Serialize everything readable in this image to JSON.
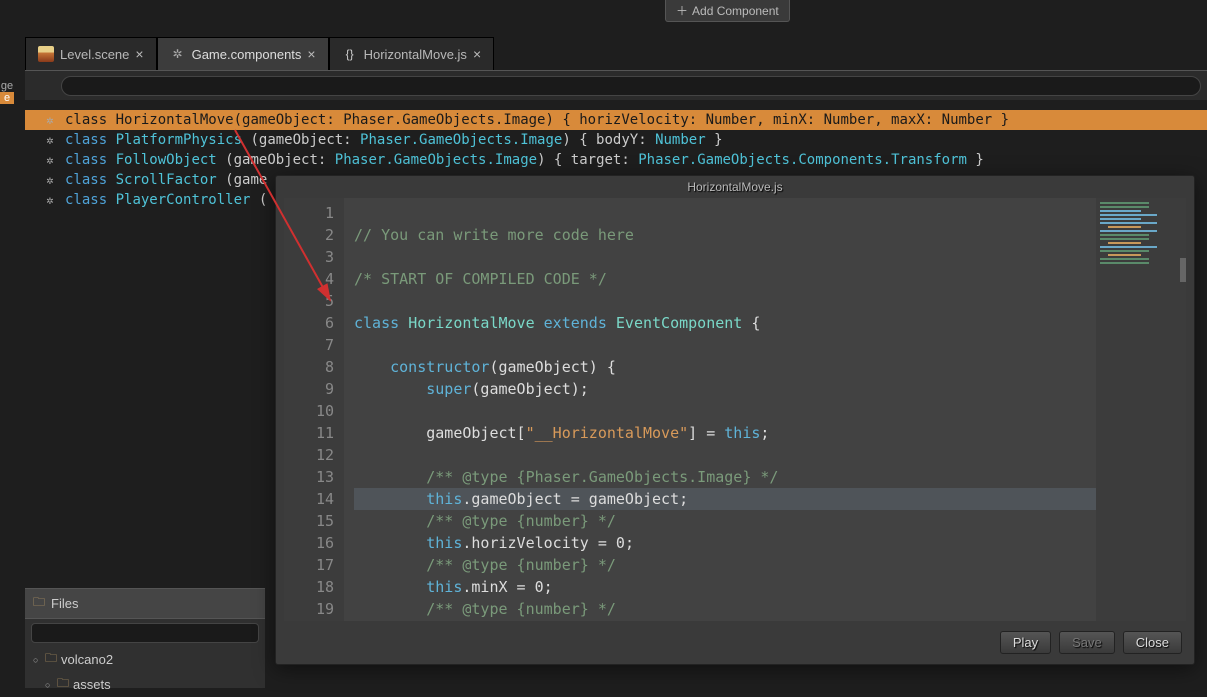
{
  "top_button": {
    "label": "Add Component"
  },
  "left_strip": {
    "items": [
      "ge",
      "e"
    ]
  },
  "tabs": [
    {
      "label": "Level.scene",
      "kind": "scene"
    },
    {
      "label": "Game.components",
      "kind": "components",
      "active": true
    },
    {
      "label": "HorizontalMove.js",
      "kind": "js"
    }
  ],
  "outline": [
    {
      "sel": true,
      "kw": "class",
      "name": "HorizontalMove",
      "sig": "(gameObject: ",
      "type": "Phaser.GameObjects.Image",
      "tail": ") { horizVelocity: Number, minX: Number, maxX: Number }"
    },
    {
      "kw": "class",
      "name": "PlatformPhysics",
      "sig": " (gameObject: ",
      "type": "Phaser.GameObjects.Image",
      "tail": ") { bodyY: ",
      "type2": "Number",
      "tail2": " }"
    },
    {
      "kw": "class",
      "name": "FollowObject",
      "sig": " (gameObject: ",
      "type": "Phaser.GameObjects.Image",
      "tail": ") { target: ",
      "type2": "Phaser.GameObjects.Components.Transform",
      "tail2": " }"
    },
    {
      "kw": "class",
      "name": "ScrollFactor",
      "sig": " (game",
      "type": "",
      "tail": ""
    },
    {
      "kw": "class",
      "name": "PlayerController",
      "sig": " (",
      "type": "",
      "tail": ""
    }
  ],
  "files": {
    "title": "Files",
    "tree": [
      {
        "name": "volcano2",
        "level": 0,
        "expandable": true
      },
      {
        "name": "assets",
        "level": 1,
        "expandable": true
      }
    ]
  },
  "preview": {
    "title": "HorizontalMove.js",
    "buttons": {
      "play": "Play",
      "save": "Save",
      "close": "Close"
    },
    "lines": [
      {
        "n": 1,
        "html": ""
      },
      {
        "n": 2,
        "html": "<span class='c-cm'>// You can write more code here</span>"
      },
      {
        "n": 3,
        "html": ""
      },
      {
        "n": 4,
        "html": "<span class='c-cm'>/* START OF COMPILED CODE */</span>"
      },
      {
        "n": 5,
        "html": ""
      },
      {
        "n": 6,
        "html": "<span class='c-kw'>class</span> <span class='c-cls'>HorizontalMove</span> <span class='c-kw'>extends</span> <span class='c-cls'>EventComponent</span> {"
      },
      {
        "n": 7,
        "html": ""
      },
      {
        "n": 8,
        "html": "    <span class='c-fn'>constructor</span>(gameObject) {"
      },
      {
        "n": 9,
        "html": "        <span class='c-kw'>super</span>(gameObject);"
      },
      {
        "n": 10,
        "html": ""
      },
      {
        "n": 11,
        "html": "        gameObject[<span class='c-str'>\"__HorizontalMove\"</span>] = <span class='c-this'>this</span>;"
      },
      {
        "n": 12,
        "html": ""
      },
      {
        "n": 13,
        "html": "        <span class='c-cm'>/** @type {Phaser.GameObjects.Image} */</span>"
      },
      {
        "n": 14,
        "hl": true,
        "html": "        <span class='c-this'>this</span>.gameObject = gameObject;"
      },
      {
        "n": 15,
        "html": "        <span class='c-cm'>/** @type {number} */</span>"
      },
      {
        "n": 16,
        "html": "        <span class='c-this'>this</span>.horizVelocity = <span class='c-num'>0</span>;"
      },
      {
        "n": 17,
        "html": "        <span class='c-cm'>/** @type {number} */</span>"
      },
      {
        "n": 18,
        "html": "        <span class='c-this'>this</span>.minX = <span class='c-num'>0</span>;"
      },
      {
        "n": 19,
        "html": "        <span class='c-cm'>/** @type {number} */</span>"
      }
    ]
  }
}
